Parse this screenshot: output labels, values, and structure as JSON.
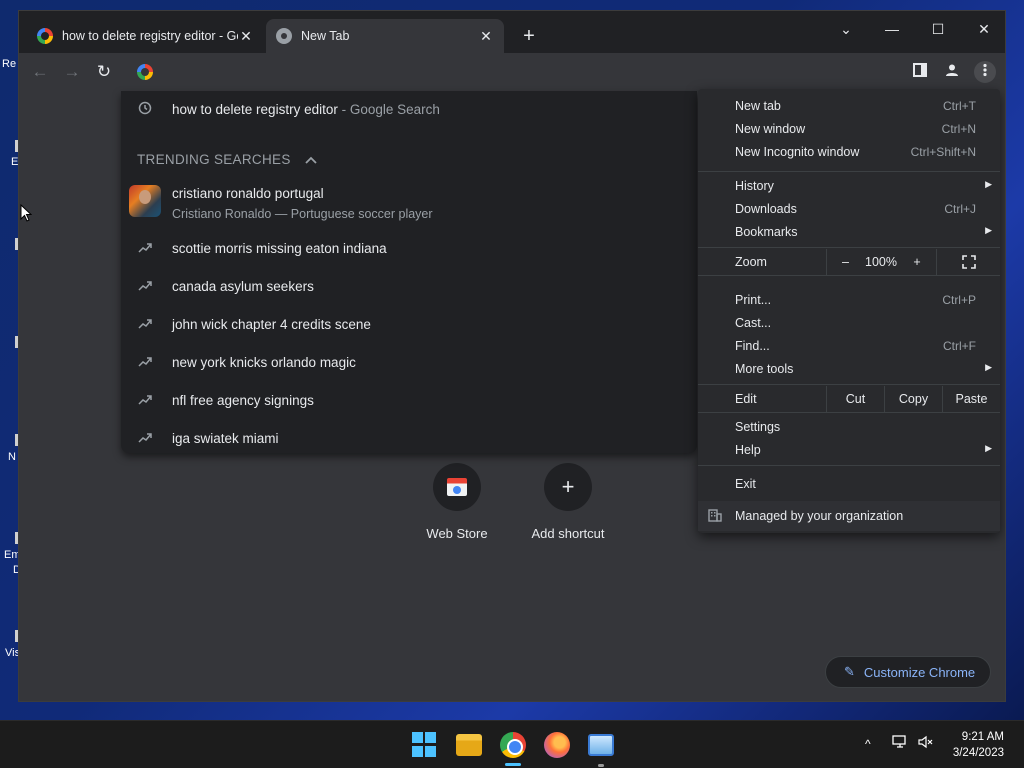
{
  "desktop": {
    "icons": [
      "Re",
      "E",
      "N",
      "Em",
      "D",
      "Vis"
    ]
  },
  "tabs": [
    {
      "title": "how to delete registry editor - Google Search",
      "icon": "google-favicon",
      "close": "✕"
    },
    {
      "title": "New Tab",
      "icon": "chrome-favicon",
      "close": "✕"
    }
  ],
  "tabstrip": {
    "new_tab": "+"
  },
  "window_controls": {
    "dropdown": "⌄",
    "minimize": "—",
    "maximize": "☐",
    "close": "✕"
  },
  "toolbar": {
    "back": "←",
    "forward": "→",
    "reload": "↻",
    "sidebar_icon": "sidebar-icon",
    "profile_icon": "profile-icon",
    "menu_icon": "kebab-icon"
  },
  "omnibox_dropdown": {
    "history_item": {
      "query": "how to delete registry editor",
      "suffix": " - Google Search"
    },
    "trending_header": "TRENDING SEARCHES",
    "trending_chevron": "^",
    "featured": {
      "title": "cristiano ronaldo portugal",
      "subtitle": "Cristiano Ronaldo — Portuguese soccer player"
    },
    "trending": [
      "scottie morris missing eaton indiana",
      "canada asylum seekers",
      "john wick chapter 4 credits scene",
      "new york knicks orlando magic",
      "nfl free agency signings",
      "iga swiatek miami"
    ]
  },
  "ntp": {
    "shortcuts": [
      {
        "label": "Web Store",
        "icon": "web-store-icon"
      },
      {
        "label": "Add shortcut",
        "icon": "plus-icon",
        "glyph": "+"
      }
    ],
    "customize_label": "Customize Chrome",
    "customize_icon": "pencil-icon"
  },
  "menu": {
    "group1": [
      {
        "label": "New tab",
        "shortcut": "Ctrl+T"
      },
      {
        "label": "New window",
        "shortcut": "Ctrl+N"
      },
      {
        "label": "New Incognito window",
        "shortcut": "Ctrl+Shift+N"
      }
    ],
    "group2": [
      {
        "label": "History",
        "shortcut": "",
        "submenu": "▶"
      },
      {
        "label": "Downloads",
        "shortcut": "Ctrl+J"
      },
      {
        "label": "Bookmarks",
        "shortcut": "",
        "submenu": "▶"
      }
    ],
    "zoom": {
      "label": "Zoom",
      "minus": "–",
      "value": "100%",
      "plus": "+",
      "fullscreen_icon": "fullscreen-icon"
    },
    "group3": [
      {
        "label": "Print...",
        "shortcut": "Ctrl+P"
      },
      {
        "label": "Cast...",
        "shortcut": ""
      },
      {
        "label": "Find...",
        "shortcut": "Ctrl+F"
      },
      {
        "label": "More tools",
        "shortcut": "",
        "submenu": "▶"
      }
    ],
    "edit": {
      "label": "Edit",
      "cut": "Cut",
      "copy": "Copy",
      "paste": "Paste"
    },
    "group4": [
      {
        "label": "Settings",
        "shortcut": ""
      },
      {
        "label": "Help",
        "shortcut": "",
        "submenu": "▶"
      }
    ],
    "exit": "Exit",
    "managed": "Managed by your organization"
  },
  "taskbar": {
    "apps": [
      "windows-start-icon",
      "file-explorer-icon",
      "chrome-icon",
      "firefox-icon",
      "remote-desktop-icon"
    ],
    "tray": {
      "chevron": "^",
      "time": "9:21 AM",
      "date": "3/24/2023"
    }
  },
  "colors": {
    "accent": "#8ab4f8",
    "menu_bg": "#292a2d",
    "dropdown_bg": "#202124",
    "page_bg": "#35363a"
  }
}
